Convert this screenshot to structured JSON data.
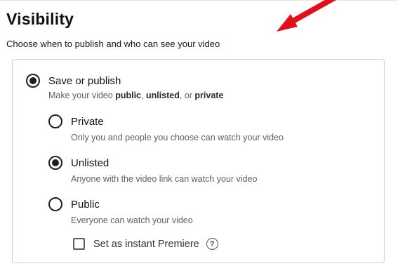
{
  "section": {
    "title": "Visibility",
    "subtitle": "Choose when to publish and who can see your video"
  },
  "save_or_publish": {
    "label": "Save or publish",
    "checked": true,
    "desc_prefix": "Make your video ",
    "desc_public": "public",
    "desc_sep1": ", ",
    "desc_unlisted": "unlisted",
    "desc_sep2": ", or ",
    "desc_private": "private"
  },
  "options": [
    {
      "label": "Private",
      "description": "Only you and people you choose can watch your video",
      "checked": false
    },
    {
      "label": "Unlisted",
      "description": "Anyone with the video link can watch your video",
      "checked": true
    },
    {
      "label": "Public",
      "description": "Everyone can watch your video",
      "checked": false
    }
  ],
  "premiere": {
    "label": "Set as instant Premiere",
    "checked": false,
    "help_glyph": "?"
  },
  "colors": {
    "annotation_arrow": "#e3101b",
    "radio": "#1f1f1f",
    "secondary_text": "#606060"
  },
  "icons": {
    "annotation": "red-arrow-icon",
    "help": "help-circle-icon"
  }
}
